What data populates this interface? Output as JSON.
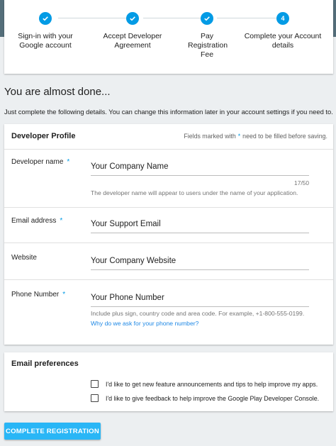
{
  "stepper": {
    "steps": [
      {
        "label": "Sign-in with your Google account",
        "status": "complete",
        "icon": "check-icon"
      },
      {
        "label": "Accept Developer Agreement",
        "status": "complete",
        "icon": "check-icon"
      },
      {
        "label": "Pay Registration Fee",
        "status": "complete",
        "icon": "check-icon"
      },
      {
        "label": "Complete your Account details",
        "status": "current",
        "number": "4"
      }
    ]
  },
  "heading": "You are almost done...",
  "intro": "Just complete the following details. You can change this information later in your account settings if you need to.",
  "profile": {
    "title": "Developer Profile",
    "required_note_before": "Fields marked with",
    "required_star": "*",
    "required_note_after": "need to be filled before saving.",
    "fields": {
      "developer_name": {
        "label": "Developer name",
        "value": "Your Company Name",
        "counter": "17/50",
        "helper": "The developer name will appear to users under the name of your application."
      },
      "email": {
        "label": "Email address",
        "value": "Your Support Email"
      },
      "website": {
        "label": "Website",
        "value": "Your Company Website"
      },
      "phone": {
        "label": "Phone Number",
        "value": "Your Phone Number",
        "helper": "Include plus sign, country code and area code. For example, +1-800-555-0199.",
        "link": "Why do we ask for your phone number?"
      }
    }
  },
  "email_prefs": {
    "title": "Email preferences",
    "options": [
      "I'd like to get new feature announcements and tips to help improve my apps.",
      "I'd like to give feedback to help improve the Google Play Developer Console."
    ]
  },
  "submit_label": "COMPLETE REGISTRATION",
  "colors": {
    "accent": "#039be5",
    "button": "#29b6f6",
    "header": "#546e7a"
  }
}
